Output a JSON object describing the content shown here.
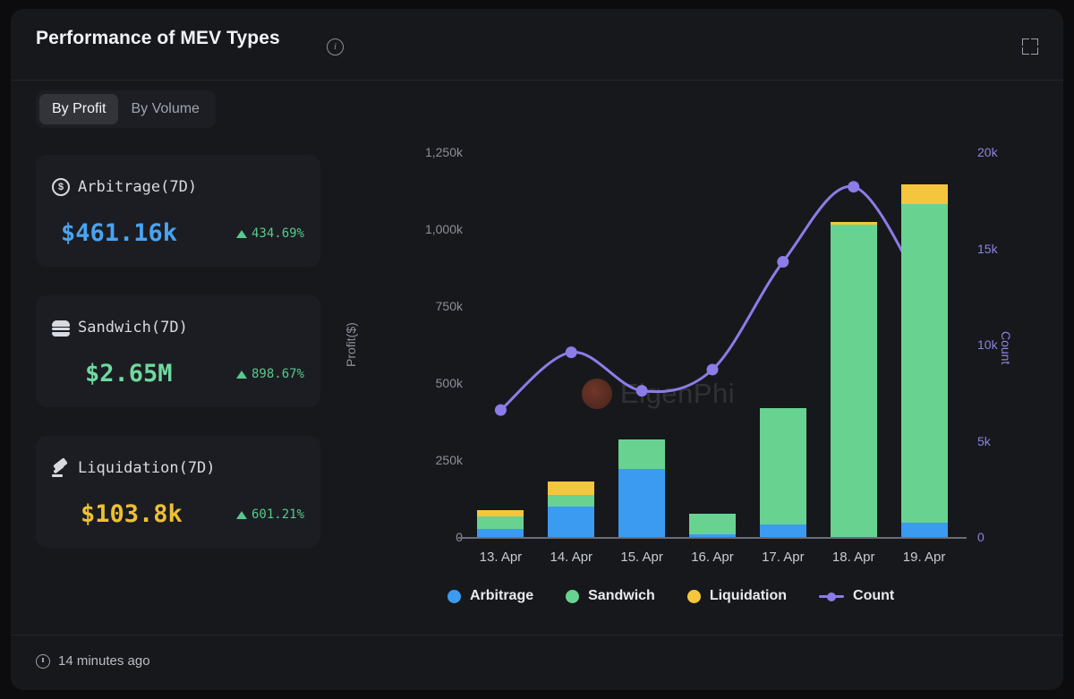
{
  "header": {
    "title": "Performance of MEV Types",
    "info_icon": "info-icon",
    "expand_icon": "expand-icon"
  },
  "tabs": [
    {
      "label": "By Profit",
      "active": true
    },
    {
      "label": "By Volume",
      "active": false
    }
  ],
  "cards": [
    {
      "icon": "coin-dollar-icon",
      "label": "Arbitrage(7D)",
      "value": "$461.16k",
      "change": "434.69%",
      "value_color": "#4aa3f0",
      "change_color": "#57c98c"
    },
    {
      "icon": "sandwich-burger-icon",
      "label": "Sandwich(7D)",
      "value": "$2.65M",
      "change": "898.67%",
      "value_color": "#6fd99f",
      "change_color": "#57c98c"
    },
    {
      "icon": "gavel-icon",
      "label": "Liquidation(7D)",
      "value": "$103.8k",
      "change": "601.21%",
      "value_color": "#edc033",
      "change_color": "#57c98c"
    }
  ],
  "watermark": "EigenPhi",
  "footer": {
    "updated": "14 minutes ago",
    "clock_icon": "clock-icon"
  },
  "chart_data": {
    "type": "bar",
    "title": "Performance of MEV Types",
    "xlabel": "",
    "ylabel": "Profit($)",
    "y2label": "Count",
    "ylim": [
      0,
      1250000
    ],
    "y2lim": [
      0,
      20000
    ],
    "grid": false,
    "legend_position": "bottom",
    "categories": [
      "13. Apr",
      "14. Apr",
      "15. Apr",
      "16. Apr",
      "17. Apr",
      "18. Apr",
      "19. Apr"
    ],
    "yticks": [
      "0",
      "250k",
      "500k",
      "750k",
      "1,000k",
      "1,250k"
    ],
    "ytick_values": [
      0,
      250000,
      500000,
      750000,
      1000000,
      1250000
    ],
    "y2ticks": [
      "0",
      "5k",
      "10k",
      "15k",
      "20k"
    ],
    "y2tick_values": [
      0,
      5000,
      10000,
      15000,
      20000
    ],
    "series": [
      {
        "name": "Arbitrage",
        "type": "bar",
        "stack": "profit",
        "color": "#3b9bf0",
        "axis": "left",
        "values": [
          25000,
          100000,
          220000,
          8000,
          42000,
          0,
          47000
        ]
      },
      {
        "name": "Sandwich",
        "type": "bar",
        "stack": "profit",
        "color": "#68d391",
        "axis": "left",
        "values": [
          41000,
          38000,
          97000,
          67000,
          378000,
          1015000,
          1035000
        ]
      },
      {
        "name": "Liquidation",
        "type": "bar",
        "stack": "profit",
        "color": "#f5c53d",
        "axis": "left",
        "values": [
          22000,
          41000,
          0,
          0,
          0,
          8000,
          63000
        ]
      },
      {
        "name": "Count",
        "type": "line",
        "color": "#8b7ce8",
        "axis": "right",
        "values": [
          6600,
          9600,
          7600,
          8700,
          14300,
          18200,
          12700
        ]
      }
    ]
  }
}
